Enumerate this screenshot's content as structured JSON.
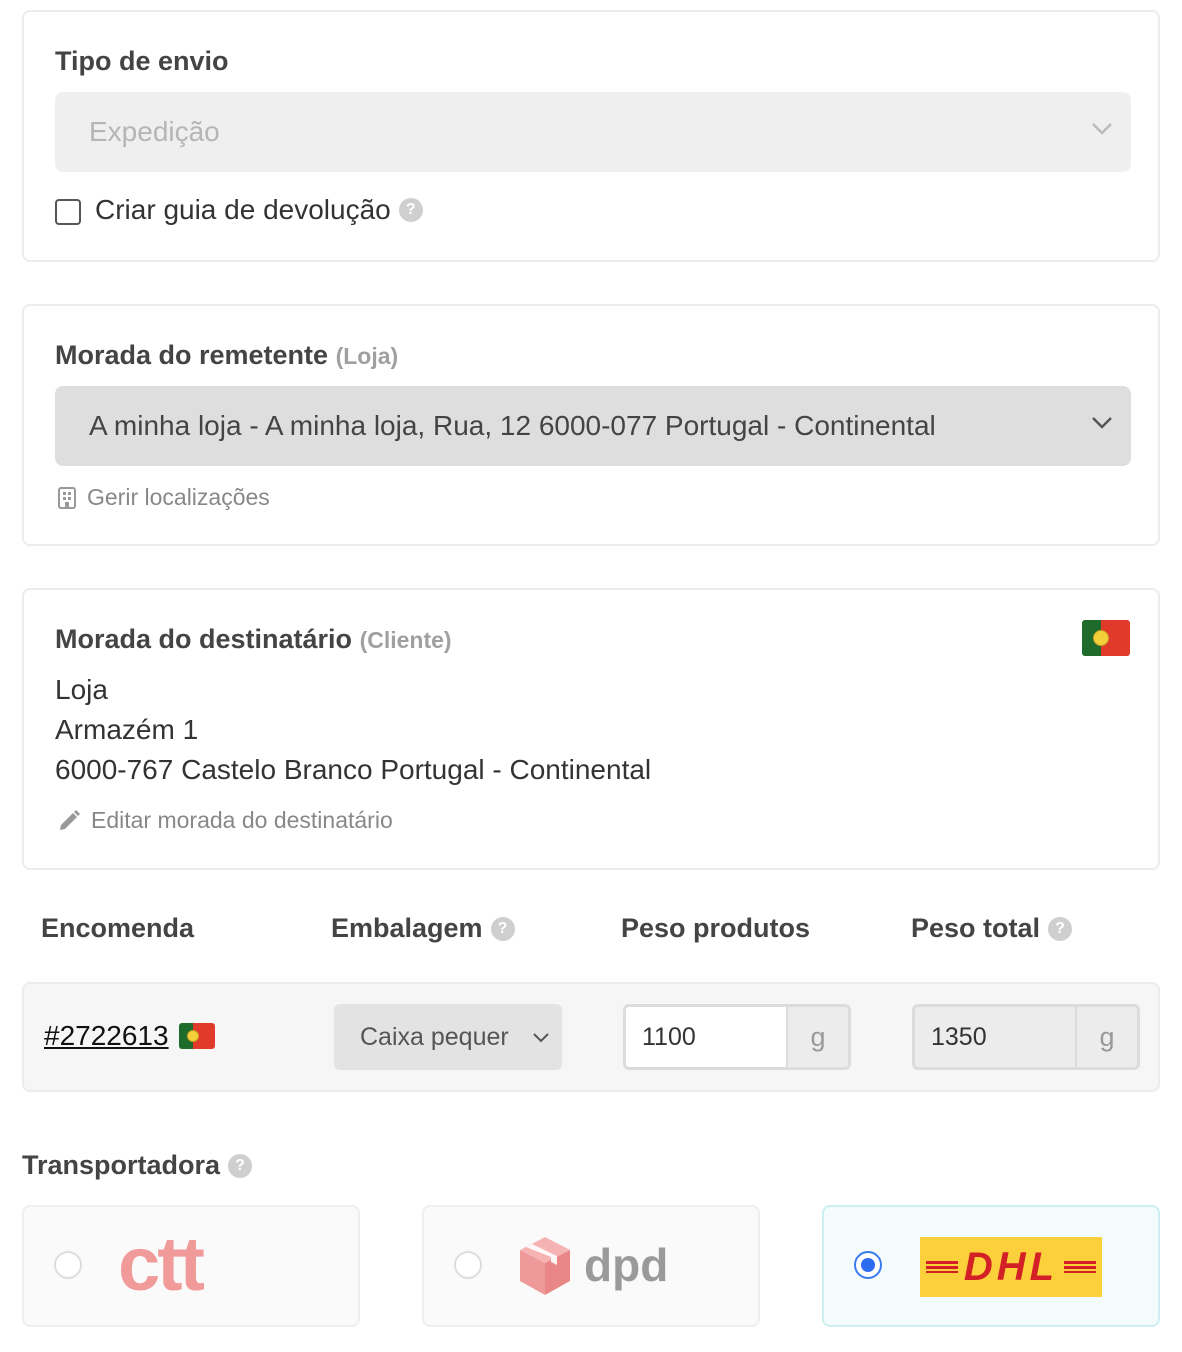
{
  "shipment_type": {
    "title": "Tipo de envio",
    "selected": "Expedição",
    "return_label": "Criar guia de devolução",
    "help_icon": "question-icon"
  },
  "sender": {
    "title": "Morada do remetente",
    "subtitle": "(Loja)",
    "selected": "A minha loja - A minha loja, Rua, 12 6000-077 Portugal - Continental",
    "manage_link": "Gerir localizações",
    "manage_icon": "building-icon"
  },
  "recipient": {
    "title": "Morada do destinatário",
    "subtitle": "(Cliente)",
    "line1": "Loja",
    "line2": "Armazém 1",
    "line3": "6000-767 Castelo Branco Portugal - Continental",
    "edit_link": "Editar morada do destinatário",
    "edit_icon": "pencil-icon",
    "flag_icon": "portugal-flag-icon"
  },
  "columns": {
    "order": "Encomenda",
    "packaging": "Embalagem",
    "product_weight": "Peso produtos",
    "total_weight": "Peso total"
  },
  "order_row": {
    "order_id": "#2722613",
    "packaging": "Caixa pequer",
    "product_weight": "1100",
    "product_weight_unit": "g",
    "total_weight": "1350",
    "total_weight_unit": "g"
  },
  "carriers": {
    "title": "Transportadora",
    "items": [
      {
        "name": "ctt",
        "logo_text": "ctt",
        "selected": false,
        "brand_color": "#f19a9a"
      },
      {
        "name": "dpd",
        "logo_text": "dpd",
        "selected": false,
        "brand_color": "#ef9a9a"
      },
      {
        "name": "DHL",
        "logo_text": "DHL",
        "selected": true,
        "brand_color": "#fcd03a"
      }
    ]
  },
  "colors": {
    "accent": "#2d6cf0",
    "muted": "#888888",
    "card_border": "#ececec"
  }
}
